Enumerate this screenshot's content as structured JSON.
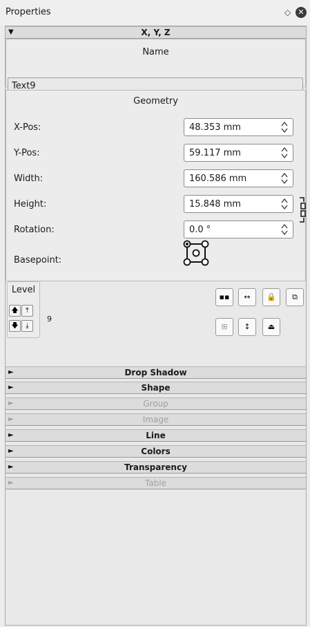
{
  "dock": {
    "title": "Properties",
    "float_icon": "diamond-icon",
    "close_icon": "close-icon"
  },
  "xyz": {
    "header": "X, Y, Z",
    "name_group_title": "Name",
    "name_value": "Text9",
    "geometry": {
      "title": "Geometry",
      "fields": [
        {
          "label": "X-Pos:",
          "value": "48.353 mm"
        },
        {
          "label": "Y-Pos:",
          "value": "59.117 mm"
        },
        {
          "label": "Width:",
          "value": "160.586 mm"
        },
        {
          "label": "Height:",
          "value": "15.848 mm"
        },
        {
          "label": "Rotation:",
          "value": "0.0 °"
        }
      ],
      "basepoint_label": "Basepoint:"
    },
    "level": {
      "title": "Level",
      "value": "9"
    }
  },
  "sections": [
    {
      "label": "Drop Shadow",
      "enabled": true
    },
    {
      "label": "Shape",
      "enabled": true
    },
    {
      "label": "Group",
      "enabled": false
    },
    {
      "label": "Image",
      "enabled": false
    },
    {
      "label": "Line",
      "enabled": true
    },
    {
      "label": "Colors",
      "enabled": true
    },
    {
      "label": "Transparency",
      "enabled": true
    },
    {
      "label": "Table",
      "enabled": false
    }
  ]
}
